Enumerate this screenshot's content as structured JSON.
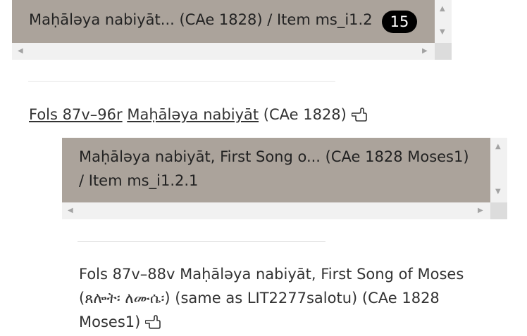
{
  "panel1": {
    "title": "Maḥāləya nabiyāt... (CAe 1828) / Item ms_i1.2",
    "badge": "15"
  },
  "entry": {
    "folio_link": "Fols 87v–96r",
    "title_link": "Maḥāləya nabiyāt",
    "suffix": "(CAe 1828)",
    "pointer_icon": "pointing-hand-icon"
  },
  "panel2": {
    "title_line1": "Maḥāləya nabiyāt, First Song o... (CAe 1828 Moses1)",
    "title_line2": "/ Item ms_i1.2.1"
  },
  "subentry": {
    "line1": "Fols 87v–88v Maḥāləya nabiyāt, First Song of Moses",
    "line2": "(ጸሎት፡ ለሙሴ፡) (same as LIT2277salotu) (CAe 1828",
    "line3": "Moses1)",
    "pointer_icon": "pointing-hand-icon"
  }
}
